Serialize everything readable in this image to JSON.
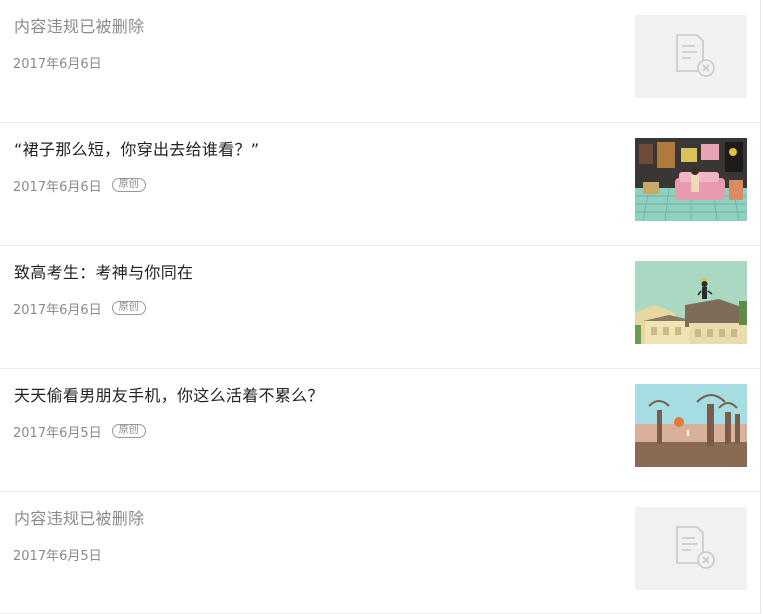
{
  "articles": [
    {
      "title": "内容违规已被删除",
      "date": "2017年6月6日",
      "badge": "",
      "deleted": true,
      "thumbnail": "deleted-placeholder-icon"
    },
    {
      "title": "“裙子那么短，你穿出去给谁看？”",
      "date": "2017年6月6日",
      "badge": "原创",
      "deleted": false,
      "thumbnail": "illustration-room"
    },
    {
      "title": "致高考生：考神与你同在",
      "date": "2017年6月6日",
      "badge": "原创",
      "deleted": false,
      "thumbnail": "illustration-rooftops"
    },
    {
      "title": "天天偷看男朋友手机，你这么活着不累么？",
      "date": "2017年6月5日",
      "badge": "原创",
      "deleted": false,
      "thumbnail": "illustration-baobab"
    },
    {
      "title": "内容违规已被删除",
      "date": "2017年6月5日",
      "badge": "",
      "deleted": true,
      "thumbnail": "deleted-placeholder-icon"
    }
  ]
}
